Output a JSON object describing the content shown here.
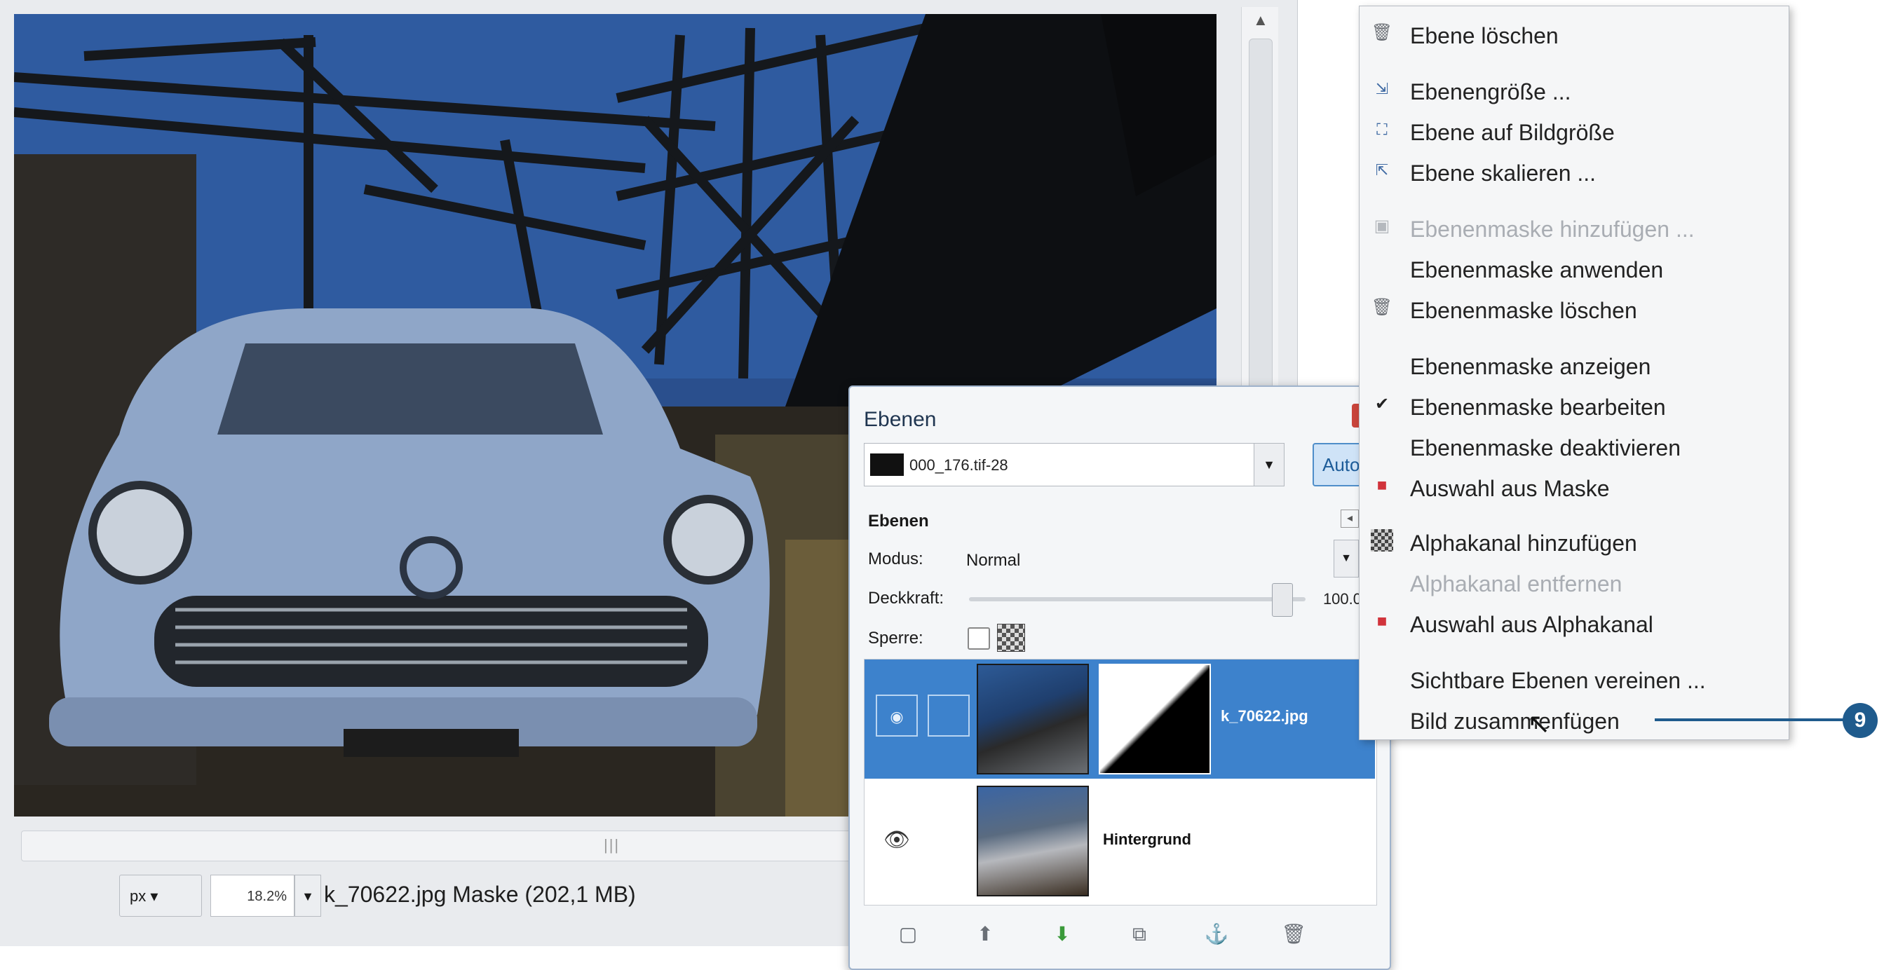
{
  "statusbar": {
    "unit": "px",
    "zoom": "18.2%",
    "image_info": "k_70622.jpg Maske (202,1 MB)"
  },
  "layers_dialog": {
    "title": "Ebenen",
    "image_name": "000_176.tif-28",
    "auto_button": "Auto",
    "section_label": "Ebenen",
    "mode_label": "Modus:",
    "mode_value": "Normal",
    "opacity_label": "Deckkraft:",
    "opacity_value": "100.0",
    "lock_label": "Sperre:",
    "layers": [
      {
        "name": "k_70622.jpg",
        "selected": true,
        "has_mask": true
      },
      {
        "name": "Hintergrund",
        "selected": false,
        "has_mask": false
      }
    ]
  },
  "context_menu": {
    "items": [
      {
        "label": "Ebene löschen",
        "icon": "trash-icon",
        "enabled": true
      },
      {
        "label": "Ebenengröße ...",
        "icon": "layer-size-icon",
        "enabled": true
      },
      {
        "label": "Ebene auf Bildgröße",
        "icon": "layer-to-image-size-icon",
        "enabled": true
      },
      {
        "label": "Ebene skalieren ...",
        "icon": "scale-layer-icon",
        "enabled": true
      },
      {
        "label": "Ebenenmaske hinzufügen ...",
        "icon": "add-mask-icon",
        "enabled": false
      },
      {
        "label": "Ebenenmaske anwenden",
        "icon": "",
        "enabled": true
      },
      {
        "label": "Ebenenmaske löschen",
        "icon": "trash-icon",
        "enabled": true
      },
      {
        "label": "Ebenenmaske anzeigen",
        "icon": "",
        "enabled": true
      },
      {
        "label": "Ebenenmaske bearbeiten",
        "icon": "check-icon",
        "enabled": true
      },
      {
        "label": "Ebenenmaske deaktivieren",
        "icon": "",
        "enabled": true
      },
      {
        "label": "Auswahl aus Maske",
        "icon": "selection-icon",
        "enabled": true
      },
      {
        "label": "Alphakanal hinzufügen",
        "icon": "alpha-icon",
        "enabled": true
      },
      {
        "label": "Alphakanal entfernen",
        "icon": "",
        "enabled": false
      },
      {
        "label": "Auswahl aus Alphakanal",
        "icon": "selection-icon",
        "enabled": true
      },
      {
        "label": "Sichtbare Ebenen vereinen ...",
        "icon": "",
        "enabled": true
      },
      {
        "label": "Bild zusammenfügen",
        "icon": "",
        "enabled": true
      }
    ]
  },
  "callout": {
    "number": "9"
  },
  "colors": {
    "accent": "#3d82cc",
    "callout": "#1f5b8d",
    "danger": "#d1333b"
  }
}
